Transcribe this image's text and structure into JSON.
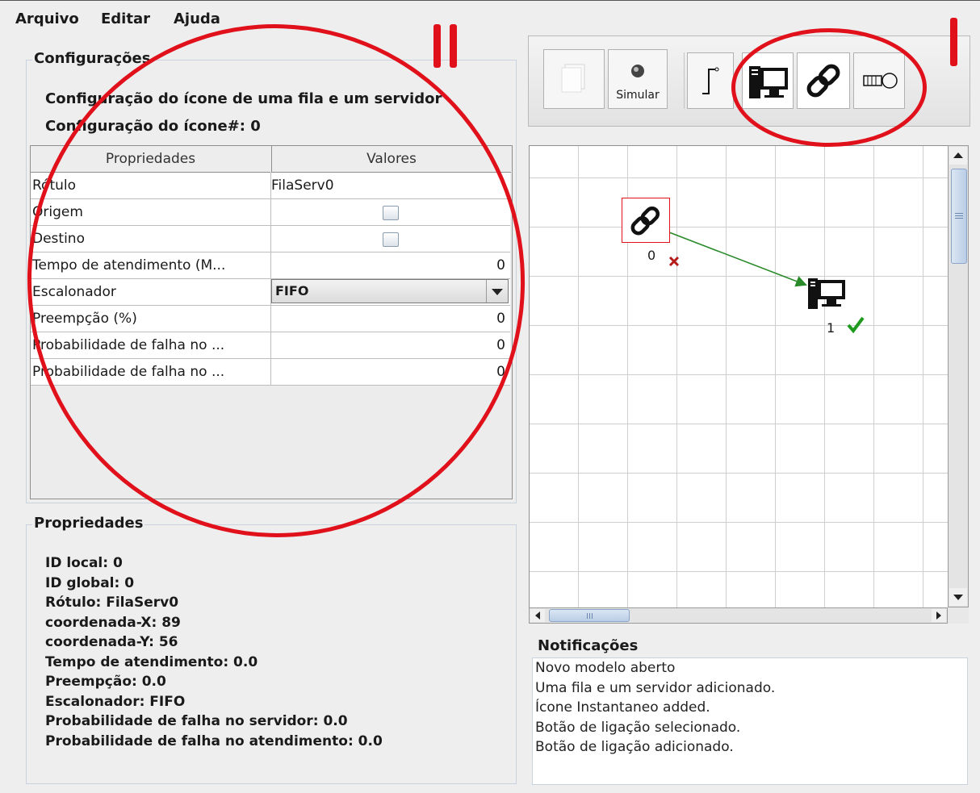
{
  "menu": {
    "items": [
      "Arquivo",
      "Editar",
      "Ajuda"
    ]
  },
  "config": {
    "legend": "Configurações",
    "title": "Configuração do ícone de uma fila e um servidor",
    "icon_no": "Configuração do ícone#: 0",
    "table": {
      "headers": [
        "Propriedades",
        "Valores"
      ],
      "rows": [
        {
          "prop": "Rótulo",
          "value": "FilaServ0",
          "kind": "text"
        },
        {
          "prop": "Origem",
          "value": "",
          "kind": "checkbox",
          "checked": false
        },
        {
          "prop": "Destino",
          "value": "",
          "kind": "checkbox",
          "checked": false
        },
        {
          "prop": "Tempo de atendimento (M...",
          "value": "0",
          "kind": "number"
        },
        {
          "prop": "Escalonador",
          "value": "FIFO",
          "kind": "combo"
        },
        {
          "prop": "Preempção (%)",
          "value": "0",
          "kind": "number"
        },
        {
          "prop": "Probabilidade de falha no ...",
          "value": "0",
          "kind": "number"
        },
        {
          "prop": "Probabilidade de falha no ...",
          "value": "0",
          "kind": "number"
        }
      ]
    }
  },
  "properties": {
    "legend": "Propriedades",
    "lines": [
      "ID local: 0",
      "ID global: 0",
      "Rótulo: FilaServ0",
      "coordenada-X: 89",
      "coordenada-Y: 56",
      "Tempo de atendimento: 0.0",
      "Preempção: 0.0",
      "Escalonador: FIFO",
      "Probabilidade de falha no servidor: 0.0",
      "Probabilidade de falha no atendimento: 0.0"
    ]
  },
  "toolbar": {
    "simulate_label": "Simular"
  },
  "canvas": {
    "nodes": [
      {
        "label": "0",
        "status": "error",
        "icon": "link-icon"
      },
      {
        "label": "1",
        "status": "ok",
        "icon": "server-icon"
      }
    ]
  },
  "notifications": {
    "legend": "Notificações",
    "lines": [
      "Novo modelo aberto",
      "Uma fila e um servidor adicionado.",
      "Ícone Instantaneo added.",
      "Botão de ligação selecionado.",
      "Botão de ligação adicionado."
    ]
  },
  "annotations": {
    "left_mark": "II",
    "right_mark": "I",
    "color": "#e0111b"
  },
  "colors": {
    "selection": "#e0111b",
    "ok": "#1e9a1e",
    "error": "#b51a1a",
    "arrow": "#2a8a2a"
  }
}
